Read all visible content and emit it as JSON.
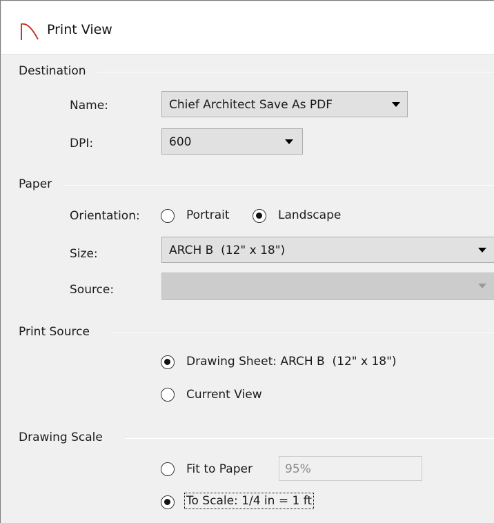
{
  "window": {
    "title": "Print View"
  },
  "destination": {
    "label": "Destination",
    "name_label": "Name:",
    "name_value": "Chief Architect Save As PDF",
    "dpi_label": "DPI:",
    "dpi_value": "600"
  },
  "paper": {
    "label": "Paper",
    "orientation_label": "Orientation:",
    "portrait_label": "Portrait",
    "landscape_label": "Landscape",
    "orientation_selected": "Landscape",
    "size_label": "Size:",
    "size_value": "ARCH B  (12\" x 18\")",
    "source_label": "Source:",
    "source_value": ""
  },
  "print_source": {
    "label": "Print Source",
    "drawing_sheet_label": "Drawing Sheet: ARCH B  (12\" x 18\")",
    "current_view_label": "Current View",
    "selected": "Drawing Sheet"
  },
  "drawing_scale": {
    "label": "Drawing Scale",
    "fit_label": "Fit to Paper",
    "fit_value": "95%",
    "to_scale_label": "To Scale: 1/4 in = 1 ft",
    "selected": "To Scale"
  },
  "icons": {
    "title": "arch-logo-icon",
    "dropdown": "chevron-down-icon"
  },
  "colors": {
    "logo": "#c0392b"
  }
}
